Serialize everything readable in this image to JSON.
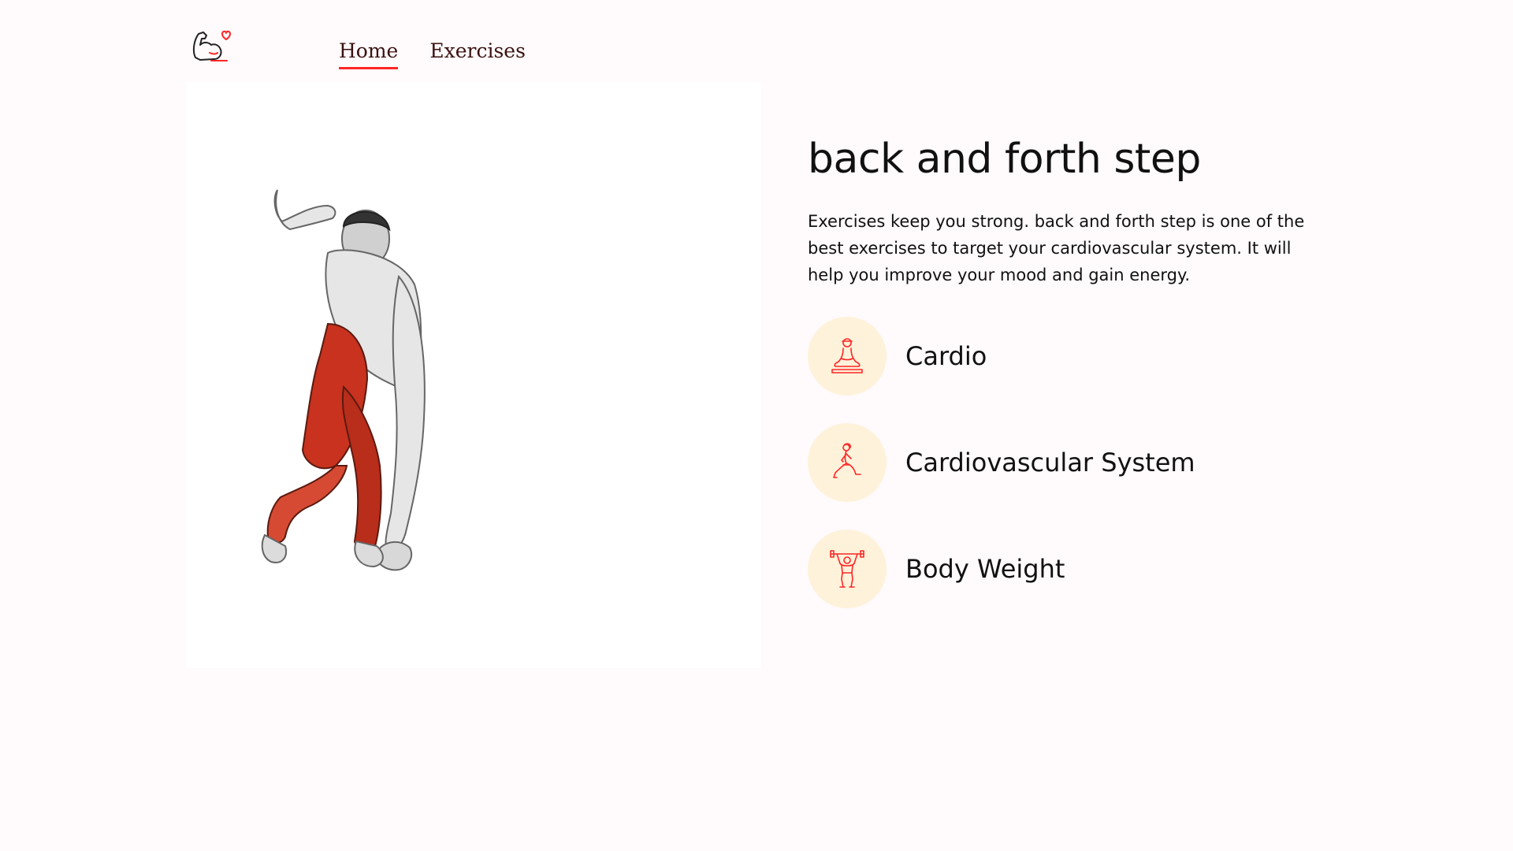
{
  "header": {
    "logo_icon": "flexed-arm-heart-logo-icon",
    "nav": [
      {
        "label": "Home",
        "active": true
      },
      {
        "label": "Exercises",
        "active": false
      }
    ]
  },
  "exercise": {
    "image_icon": "muscle-anatomy-figure",
    "name": "back and forth step",
    "description": "Exercises keep you strong. back and forth step is one of the best exercises to target your cardiovascular system. It will help you improve your mood and gain energy.",
    "tags": [
      {
        "label": "Cardio",
        "icon": "meditation-pose-icon"
      },
      {
        "label": "Cardiovascular System",
        "icon": "lunge-pose-icon"
      },
      {
        "label": "Body Weight",
        "icon": "weightlifter-icon"
      }
    ]
  },
  "colors": {
    "accent": "#ff2625",
    "background": "#fffafb",
    "tag_circle": "#fff2db",
    "nav_text": "#3a1212"
  }
}
